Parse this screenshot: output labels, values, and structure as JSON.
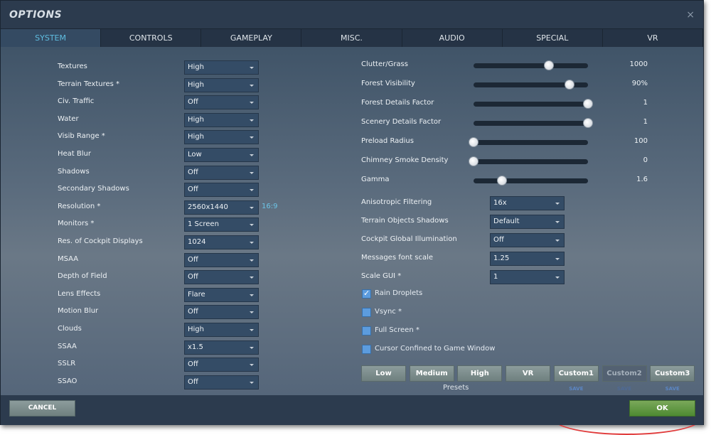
{
  "window": {
    "title": "OPTIONS",
    "close": "×"
  },
  "tabs": [
    "SYSTEM",
    "CONTROLS",
    "GAMEPLAY",
    "MISC.",
    "AUDIO",
    "SPECIAL",
    "VR"
  ],
  "left_settings": [
    {
      "label": "Textures",
      "value": "High"
    },
    {
      "label": "Terrain Textures *",
      "value": "High"
    },
    {
      "label": "Civ. Traffic",
      "value": "Off"
    },
    {
      "label": "Water",
      "value": "High"
    },
    {
      "label": "Visib Range *",
      "value": "High"
    },
    {
      "label": "Heat Blur",
      "value": "Low"
    },
    {
      "label": "Shadows",
      "value": "Off"
    },
    {
      "label": "Secondary Shadows",
      "value": "Off"
    },
    {
      "label": "Resolution *",
      "value": "2560x1440",
      "aspect": "16:9"
    },
    {
      "label": "Monitors *",
      "value": "1 Screen"
    },
    {
      "label": "Res. of Cockpit Displays",
      "value": "1024"
    },
    {
      "label": "MSAA",
      "value": "Off"
    },
    {
      "label": "Depth of Field",
      "value": "Off"
    },
    {
      "label": "Lens Effects",
      "value": "Flare"
    },
    {
      "label": "Motion Blur",
      "value": "Off"
    },
    {
      "label": "Clouds",
      "value": "High"
    },
    {
      "label": "SSAA",
      "value": "x1.5"
    },
    {
      "label": "SSLR",
      "value": "Off"
    },
    {
      "label": "SSAO",
      "value": "Off"
    }
  ],
  "sliders": [
    {
      "label": "Clutter/Grass",
      "value": "1000",
      "fraction": 0.66
    },
    {
      "label": "Forest Visibility",
      "value": "90%",
      "fraction": 0.84
    },
    {
      "label": "Forest Details Factor",
      "value": "1",
      "fraction": 1.0
    },
    {
      "label": "Scenery Details Factor",
      "value": "1",
      "fraction": 1.0
    },
    {
      "label": "Preload Radius",
      "value": "100",
      "fraction": 0.0
    },
    {
      "label": "Chimney Smoke Density",
      "value": "0",
      "fraction": 0.0
    },
    {
      "label": "Gamma",
      "value": "1.6",
      "fraction": 0.25
    }
  ],
  "right_dropdowns": [
    {
      "label": "Anisotropic Filtering",
      "value": "16x"
    },
    {
      "label": "Terrain Objects Shadows",
      "value": "Default"
    },
    {
      "label": "Cockpit Global Illumination",
      "value": "Off"
    },
    {
      "label": "Messages font scale",
      "value": "1.25"
    },
    {
      "label": "Scale GUI *",
      "value": "1"
    }
  ],
  "checkboxes": [
    {
      "label": "Rain Droplets",
      "checked": true
    },
    {
      "label": "Vsync *",
      "checked": false
    },
    {
      "label": "Full Screen *",
      "checked": false
    },
    {
      "label": "Cursor Confined to Game Window",
      "checked": false
    }
  ],
  "presets": {
    "label": "Presets",
    "buttons": [
      "Low",
      "Medium",
      "High",
      "VR",
      "Custom1",
      "Custom2",
      "Custom3"
    ],
    "save": "SAVE"
  },
  "footer": {
    "cancel": "CANCEL",
    "ok": "OK"
  }
}
